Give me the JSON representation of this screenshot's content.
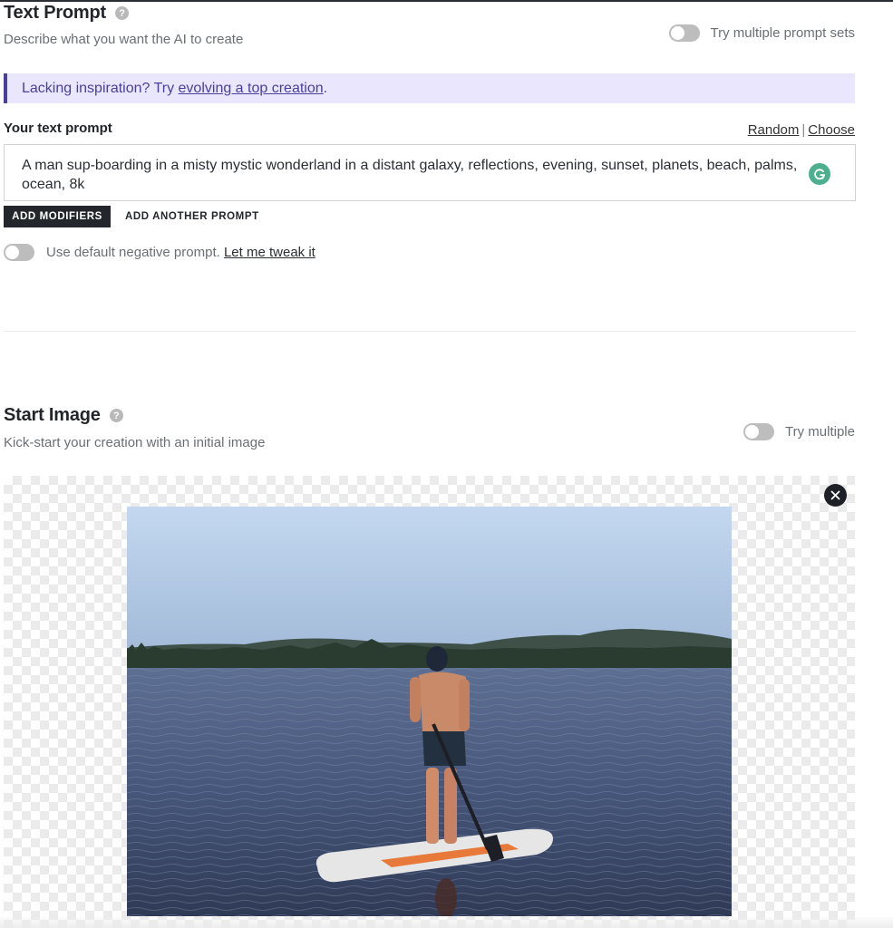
{
  "text_prompt": {
    "title": "Text Prompt",
    "help_icon": "question-circle-icon",
    "subtitle": "Describe what you want the AI to create",
    "multi_toggle": {
      "label": "Try multiple prompt sets",
      "enabled": false
    }
  },
  "banner": {
    "prefix": "Lacking inspiration? Try ",
    "link": "evolving a top creation",
    "suffix": ".",
    "accent_color": "#4a3f9a",
    "background_color": "#e9e6fd"
  },
  "prompt_field": {
    "label": "Your text prompt",
    "random_link": "Random",
    "separator": "|",
    "choose_link": "Choose",
    "value": "A man sup-boarding in a misty mystic wonderland in a distant galaxy, reflections, evening, sunset, planets, beach, palms, ocean, 8k",
    "extension_icon": "grammarly-icon"
  },
  "actions": {
    "add_modifiers": "ADD MODIFIERS",
    "add_another_prompt": "ADD ANOTHER PROMPT"
  },
  "negative_prompt": {
    "enabled": false,
    "label": "Use default negative prompt. ",
    "tweak_link": "Let me tweak it"
  },
  "start_image": {
    "title": "Start Image",
    "help_icon": "question-circle-icon",
    "subtitle": "Kick-start your creation with an initial image",
    "multi_toggle": {
      "label": "Try multiple",
      "enabled": false
    },
    "remove_icon": "close-icon",
    "image_description": "Man standing on an orange and white paddle board on a lake with forested hills under a clear blue sky"
  }
}
